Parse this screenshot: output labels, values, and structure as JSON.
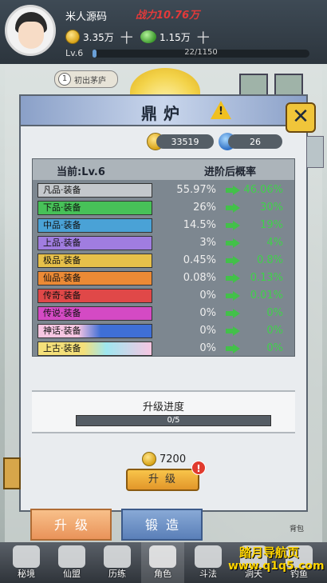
{
  "player": {
    "name": "米人源码",
    "power": "战力10.76万",
    "gold": "3.35万",
    "jade": "1.15万",
    "plus": "十",
    "level": "Lv.6",
    "exp": "22/1150",
    "exp_ratio": 0.019
  },
  "scene": {
    "chushou_num": "1",
    "chushou_label": "初出茅庐",
    "bag_label": "背包"
  },
  "dialog": {
    "title": "鼎炉",
    "warn": "!",
    "close": "✕",
    "coins": "33519",
    "gems": "26",
    "table": {
      "col1": "当前:Lv.6",
      "col2": "进阶后概率",
      "rows": [
        {
          "name": "凡品·装备",
          "old": "55.97%",
          "new": "46.06%",
          "color": "#c4c8cc"
        },
        {
          "name": "下品·装备",
          "old": "26%",
          "new": "30%",
          "color": "#47c158"
        },
        {
          "name": "中品·装备",
          "old": "14.5%",
          "new": "19%",
          "color": "#4aa2d6"
        },
        {
          "name": "上品·装备",
          "old": "3%",
          "new": "4%",
          "color": "#a07de0"
        },
        {
          "name": "极品·装备",
          "old": "0.45%",
          "new": "0.8%",
          "color": "#e6c04a"
        },
        {
          "name": "仙品·装备",
          "old": "0.08%",
          "new": "0.13%",
          "color": "#ec8a35"
        },
        {
          "name": "传奇·装备",
          "old": "0%",
          "new": "0.01%",
          "color": "#e04848"
        },
        {
          "name": "传说·装备",
          "old": "0%",
          "new": "0%",
          "color": "#d44ac4"
        },
        {
          "name": "神话·装备",
          "old": "0%",
          "new": "0%",
          "color": "#3f6fd6"
        },
        {
          "name": "上古·装备",
          "old": "0%",
          "new": "0%",
          "color": "#f7c6e2"
        }
      ]
    },
    "progress_title": "升级进度",
    "progress_text": "0/5",
    "cost": "7200",
    "upgrade_btn": "升级",
    "red_badge": "!"
  },
  "tabs": {
    "upgrade": "升级",
    "forge": "锻造"
  },
  "nav": [
    {
      "label": "秘境"
    },
    {
      "label": "仙盟"
    },
    {
      "label": "历练"
    },
    {
      "label": "角色"
    },
    {
      "label": "斗法"
    },
    {
      "label": "洞天"
    },
    {
      "label": "钓鱼"
    }
  ],
  "watermark": {
    "line1": "踏月导航页",
    "line2": "www.q1q5.com"
  }
}
